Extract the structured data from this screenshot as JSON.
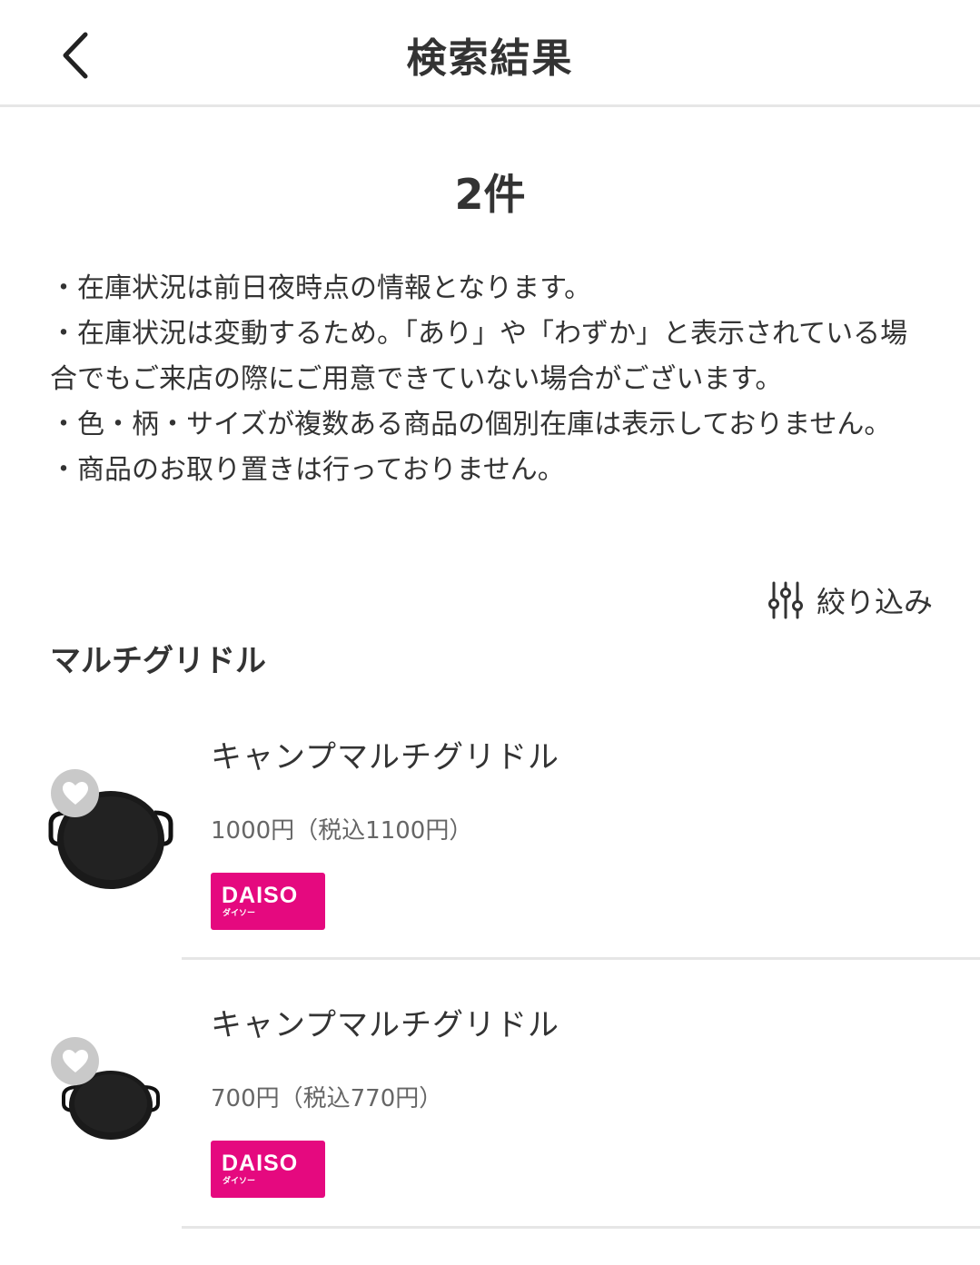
{
  "header": {
    "back_icon": "chevron-left-icon",
    "title": "検索結果"
  },
  "result_count": "2件",
  "notes": [
    "・在庫状況は前日夜時点の情報となります。",
    "・在庫状況は変動するため。「あり」や「わずか」と表示されている場合でもご来店の際にご用意できていない場合がございます。",
    "・色・柄・サイズが複数ある商品の個別在庫は表示しておりません。",
    "・商品のお取り置きは行っておりません。"
  ],
  "filter": {
    "icon": "sliders-icon",
    "label": "絞り込み"
  },
  "section": {
    "title": "マルチグリドル"
  },
  "products": [
    {
      "name": "キャンプマルチグリドル",
      "price": "1000円（税込1100円）",
      "brand": "DAISO",
      "brand_sub": "ダイソー",
      "favorite_icon": "heart-icon"
    },
    {
      "name": "キャンプマルチグリドル",
      "price": "700円（税込770円）",
      "brand": "DAISO",
      "brand_sub": "ダイソー",
      "favorite_icon": "heart-icon"
    }
  ],
  "colors": {
    "brand": "#e5097f",
    "text": "#333333",
    "subtext": "#666666",
    "divider": "#e6e6e6",
    "favorite_bg": "#c9c9c9"
  }
}
